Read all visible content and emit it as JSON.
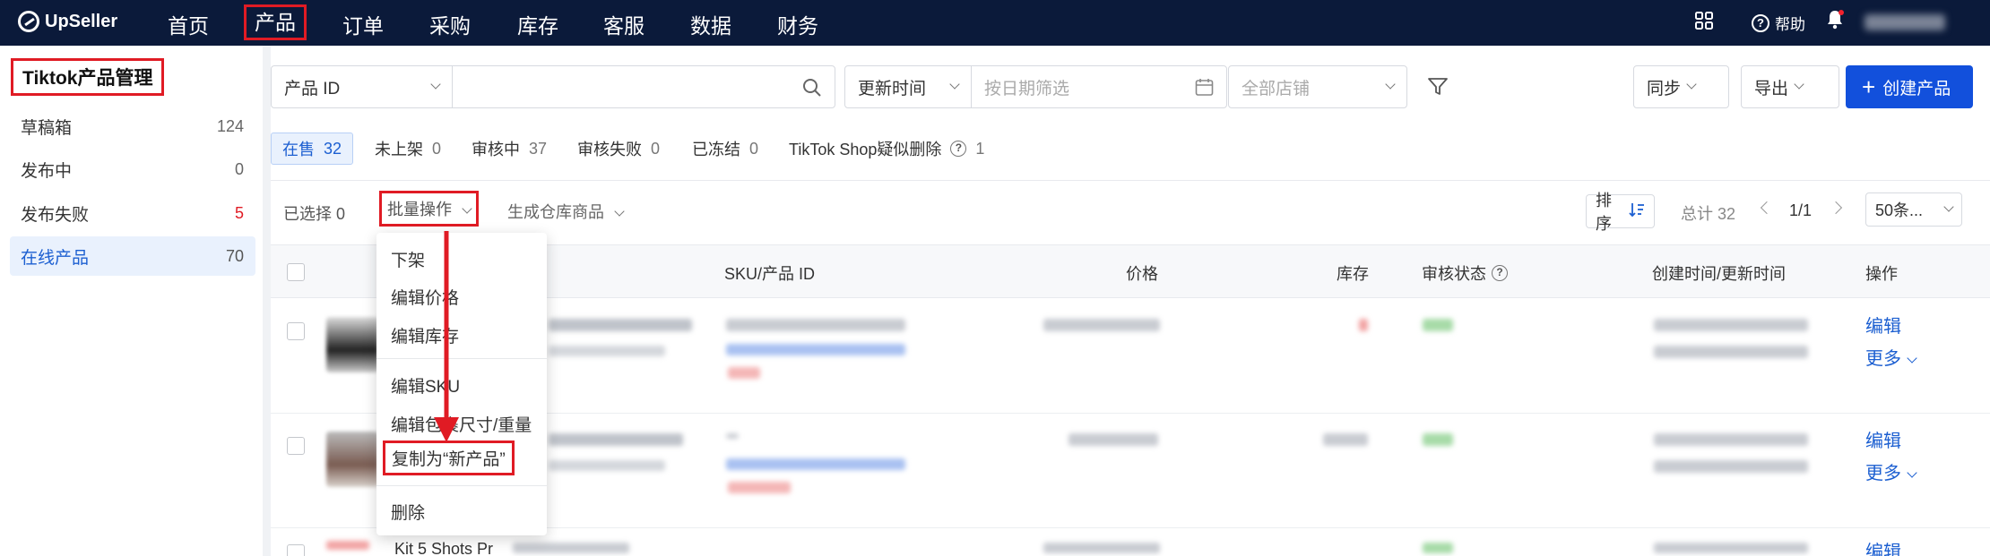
{
  "app": {
    "logo": "UpSeller"
  },
  "nav": {
    "items": [
      "首页",
      "产品",
      "订单",
      "采购",
      "库存",
      "客服",
      "数据",
      "财务"
    ],
    "active_index": 1,
    "help": "帮助"
  },
  "sidebar": {
    "title": "Tiktok产品管理",
    "items": [
      {
        "label": "草稿箱",
        "count": "124"
      },
      {
        "label": "发布中",
        "count": "0"
      },
      {
        "label": "发布失败",
        "count": "5"
      },
      {
        "label": "在线产品",
        "count": "70"
      }
    ]
  },
  "filters": {
    "id_type": "产品 ID",
    "time_type": "更新时间",
    "date_placeholder": "按日期筛选",
    "store_placeholder": "全部店铺",
    "sync": "同步",
    "export": "导出",
    "create": "创建产品"
  },
  "tabs": [
    {
      "label": "在售",
      "count": "32"
    },
    {
      "label": "未上架",
      "count": "0"
    },
    {
      "label": "审核中",
      "count": "37"
    },
    {
      "label": "审核失败",
      "count": "0"
    },
    {
      "label": "已冻结",
      "count": "0"
    },
    {
      "label": "TikTok Shop疑似删除",
      "count": "1"
    }
  ],
  "toolbar": {
    "selected": "已选择 0",
    "bulk": "批量操作",
    "gen_warehouse": "生成仓库商品",
    "sort": "排序",
    "total": "总计 32",
    "page": "1/1",
    "per_page": "50条..."
  },
  "table": {
    "headers": [
      "SKU/产品 ID",
      "价格",
      "库存",
      "审核状态",
      "创建时间/更新时间",
      "操作"
    ],
    "row_actions": {
      "edit": "编辑",
      "more": "更多"
    },
    "partial_row_text": "Kit 5 Shots Pr"
  },
  "bulk_menu": {
    "items": [
      "下架",
      "编辑价格",
      "编辑库存",
      "编辑SKU",
      "编辑包裹尺寸/重量",
      "复制为“新产品”",
      "删除"
    ]
  },
  "colors": {
    "nav_bg": "#0b1a3a",
    "primary": "#1250dc",
    "highlight": "#e01b24"
  }
}
